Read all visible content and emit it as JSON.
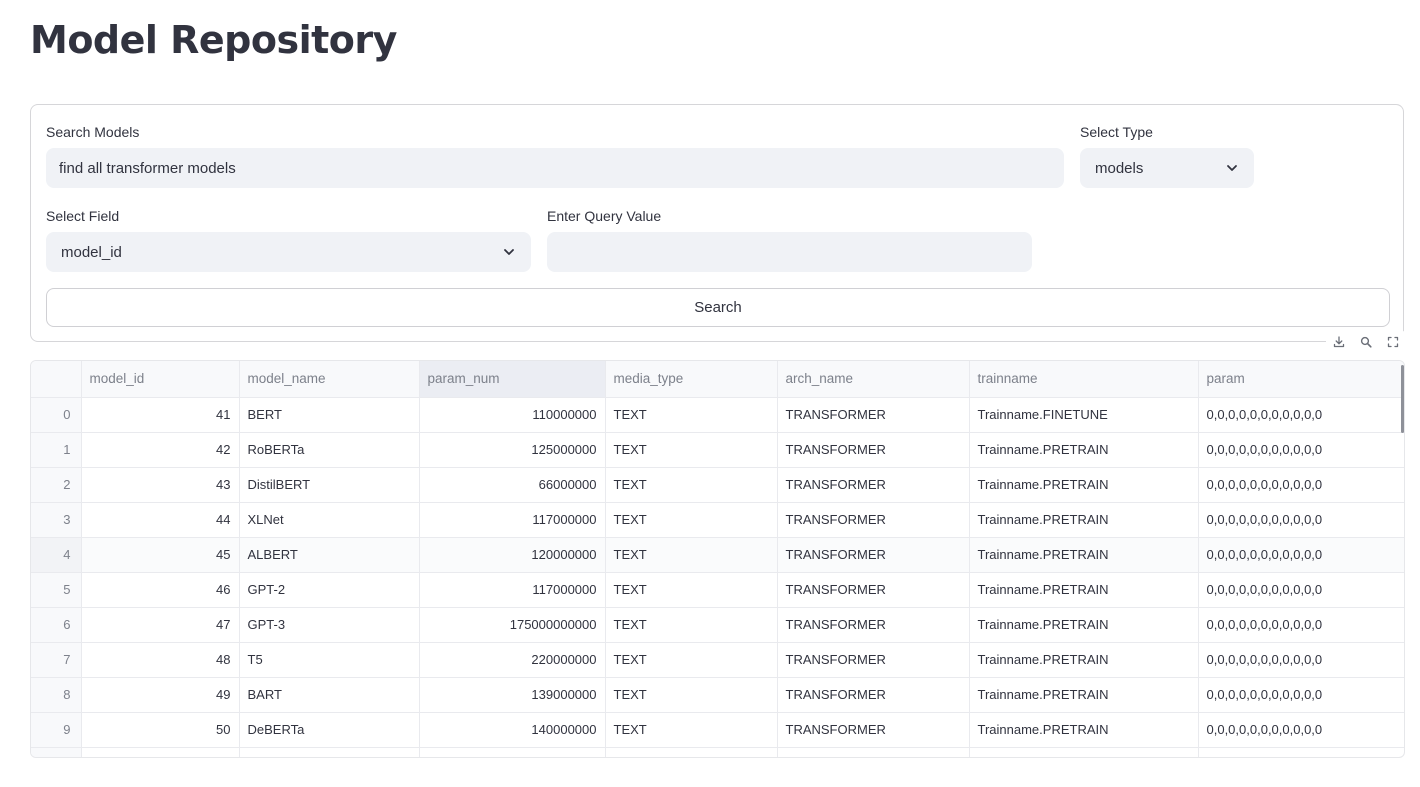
{
  "page": {
    "title": "Model Repository"
  },
  "form": {
    "search_label": "Search Models",
    "search_value": "find all transformer models",
    "type_label": "Select Type",
    "type_value": "models",
    "field_label": "Select Field",
    "field_value": "model_id",
    "query_label": "Enter Query Value",
    "query_value": "",
    "search_button": "Search"
  },
  "toolbar": {
    "icons": [
      "download-icon",
      "search-icon",
      "fullscreen-icon"
    ]
  },
  "table": {
    "columns": [
      "",
      "model_id",
      "model_name",
      "param_num",
      "media_type",
      "arch_name",
      "trainname",
      "param"
    ],
    "rows": [
      [
        "0",
        "41",
        "BERT",
        "110000000",
        "TEXT",
        "TRANSFORMER",
        "Trainname.FINETUNE",
        "0,0,0,0,0,0,0,0,0,0,0"
      ],
      [
        "1",
        "42",
        "RoBERTa",
        "125000000",
        "TEXT",
        "TRANSFORMER",
        "Trainname.PRETRAIN",
        "0,0,0,0,0,0,0,0,0,0,0"
      ],
      [
        "2",
        "43",
        "DistilBERT",
        "66000000",
        "TEXT",
        "TRANSFORMER",
        "Trainname.PRETRAIN",
        "0,0,0,0,0,0,0,0,0,0,0"
      ],
      [
        "3",
        "44",
        "XLNet",
        "117000000",
        "TEXT",
        "TRANSFORMER",
        "Trainname.PRETRAIN",
        "0,0,0,0,0,0,0,0,0,0,0"
      ],
      [
        "4",
        "45",
        "ALBERT",
        "120000000",
        "TEXT",
        "TRANSFORMER",
        "Trainname.PRETRAIN",
        "0,0,0,0,0,0,0,0,0,0,0"
      ],
      [
        "5",
        "46",
        "GPT-2",
        "117000000",
        "TEXT",
        "TRANSFORMER",
        "Trainname.PRETRAIN",
        "0,0,0,0,0,0,0,0,0,0,0"
      ],
      [
        "6",
        "47",
        "GPT-3",
        "175000000000",
        "TEXT",
        "TRANSFORMER",
        "Trainname.PRETRAIN",
        "0,0,0,0,0,0,0,0,0,0,0"
      ],
      [
        "7",
        "48",
        "T5",
        "220000000",
        "TEXT",
        "TRANSFORMER",
        "Trainname.PRETRAIN",
        "0,0,0,0,0,0,0,0,0,0,0"
      ],
      [
        "8",
        "49",
        "BART",
        "139000000",
        "TEXT",
        "TRANSFORMER",
        "Trainname.PRETRAIN",
        "0,0,0,0,0,0,0,0,0,0,0"
      ],
      [
        "9",
        "50",
        "DeBERTa",
        "140000000",
        "TEXT",
        "TRANSFORMER",
        "Trainname.PRETRAIN",
        "0,0,0,0,0,0,0,0,0,0,0"
      ]
    ]
  }
}
